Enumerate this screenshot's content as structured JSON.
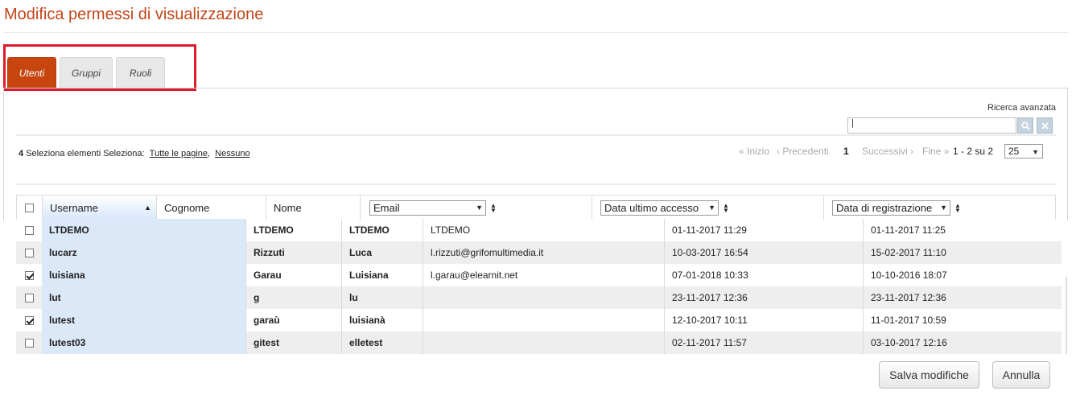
{
  "page": {
    "title": "Modifica permessi di visualizzazione"
  },
  "tabs": [
    {
      "label": "Utenti",
      "active": true
    },
    {
      "label": "Gruppi",
      "active": false
    },
    {
      "label": "Ruoli",
      "active": false
    }
  ],
  "search": {
    "advanced_label": "Ricerca avanzata",
    "value": "|",
    "search_icon": "magnifier-icon",
    "clear_icon": "x-icon"
  },
  "selection": {
    "count": "4",
    "label": "Seleziona elementi",
    "select_label": "Seleziona:",
    "all_pages": "Tutte le pagine",
    "separator": ",",
    "none": "Nessuno"
  },
  "pagination": {
    "first": "« Inizio",
    "prev": "‹ Precedenti",
    "current": "1",
    "next": "Successivi ›",
    "last": "Fine »",
    "range": "1 - 2 su 2",
    "page_size": "25"
  },
  "table": {
    "columns": {
      "username": "Username",
      "cognome": "Cognome",
      "nome": "Nome",
      "email": "Email",
      "last_access": "Data ultimo accesso",
      "registration": "Data di registrazione"
    },
    "rows": [
      {
        "checked": false,
        "username": "LTDEMO",
        "cognome": "LTDEMO",
        "nome": "LTDEMO",
        "email": "LTDEMO",
        "last_access": "01-11-2017 11:29",
        "registration": "01-11-2017 11:25"
      },
      {
        "checked": false,
        "username": "lucarz",
        "cognome": "Rizzuti",
        "nome": "Luca",
        "email": "l.rizzuti@grifomultimedia.it",
        "last_access": "10-03-2017 16:54",
        "registration": "15-02-2017 11:10"
      },
      {
        "checked": true,
        "username": "luisiana",
        "cognome": "Garau",
        "nome": "Luisiana",
        "email": "l.garau@elearnit.net",
        "last_access": "07-01-2018 10:33",
        "registration": "10-10-2016 18:07"
      },
      {
        "checked": false,
        "username": "lut",
        "cognome": "g",
        "nome": "lu",
        "email": "",
        "last_access": "23-11-2017 12:36",
        "registration": "23-11-2017 12:36"
      },
      {
        "checked": true,
        "username": "lutest",
        "cognome": "garaù",
        "nome": "luisianà",
        "email": "",
        "last_access": "12-10-2017 10:11",
        "registration": "11-01-2017 10:59"
      },
      {
        "checked": false,
        "username": "lutest03",
        "cognome": "gitest",
        "nome": "elletest",
        "email": "",
        "last_access": "02-11-2017 11:57",
        "registration": "03-10-2017 12:16"
      }
    ]
  },
  "buttons": {
    "save": "Salva modifiche",
    "cancel": "Annulla"
  },
  "colors": {
    "accent": "#c7460f",
    "title": "#c0461a",
    "highlight_box": "#dc1b2b",
    "sorted_column": "#dbe8f8"
  }
}
